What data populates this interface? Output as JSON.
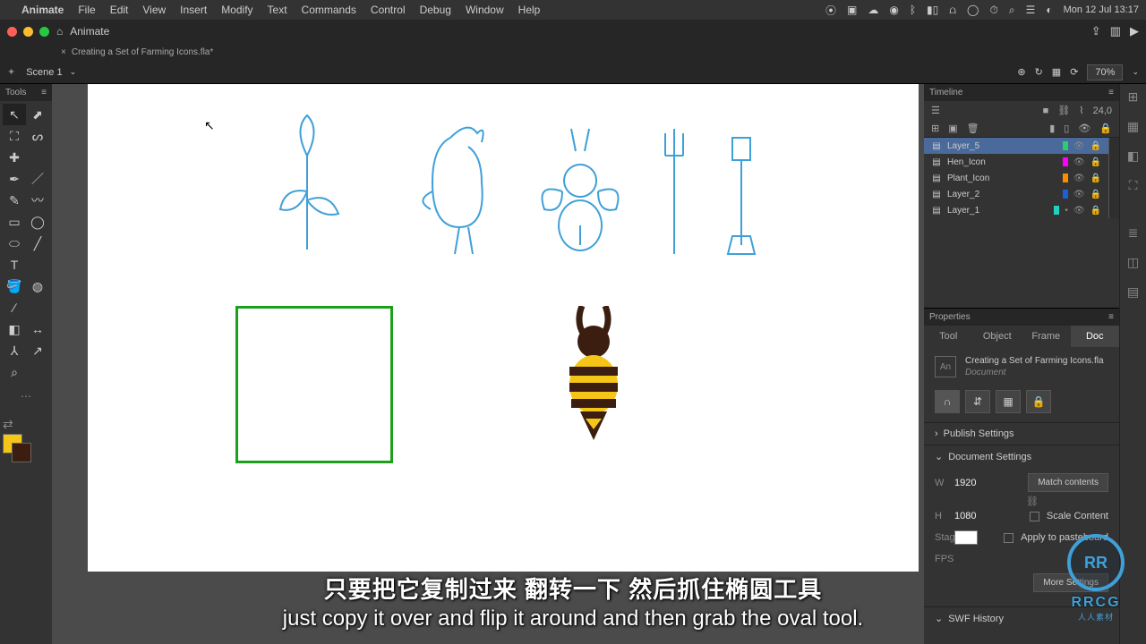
{
  "menubar": {
    "app": "Animate",
    "items": [
      "File",
      "Edit",
      "View",
      "Insert",
      "Modify",
      "Text",
      "Commands",
      "Control",
      "Debug",
      "Window",
      "Help"
    ],
    "datetime": "Mon 12 Jul 13:17"
  },
  "titlebar": {
    "app_label": "Animate"
  },
  "doctab": {
    "label": "Creating a Set of Farming Icons.fla*"
  },
  "scenebar": {
    "scene": "Scene 1",
    "zoom": "70%"
  },
  "tools": {
    "header": "Tools"
  },
  "colors": {
    "fill": "#f5c518",
    "stroke": "#3b1e0f"
  },
  "timeline": {
    "header": "Timeline",
    "frame_readout": "24,0",
    "layers": [
      {
        "name": "Layer_5",
        "color": "#2ecc71",
        "selected": true
      },
      {
        "name": "Hen_Icon",
        "color": "#ff00ff",
        "selected": false
      },
      {
        "name": "Plant_Icon",
        "color": "#ff8c00",
        "selected": false
      },
      {
        "name": "Layer_2",
        "color": "#1e5fd8",
        "selected": false
      },
      {
        "name": "Layer_1",
        "color": "#20d0c0",
        "selected": false
      }
    ]
  },
  "properties": {
    "header": "Properties",
    "tabs": [
      "Tool",
      "Object",
      "Frame",
      "Doc"
    ],
    "active_tab": "Doc",
    "doc_name": "Creating a Set of Farming Icons.fla",
    "doc_kind": "Document",
    "sections": {
      "publish": "Publish Settings",
      "docset": "Document Settings",
      "swf": "SWF History"
    },
    "width_label": "W",
    "width_value": "1920",
    "height_label": "H",
    "height_value": "1080",
    "match_btn": "Match contents",
    "scale_content": "Scale Content",
    "apply_pasteboard": "Apply to pasteboard",
    "stage_label": "Stage",
    "fps_label": "FPS",
    "more_settings": "More Settings"
  },
  "subtitle": {
    "cn": "只要把它复制过来 翻转一下 然后抓住椭圆工具",
    "en": "just copy it over and flip it around and then grab the oval tool."
  },
  "watermark": {
    "brand": "RR",
    "domain": "RRCG",
    "sub": "人人素材"
  }
}
